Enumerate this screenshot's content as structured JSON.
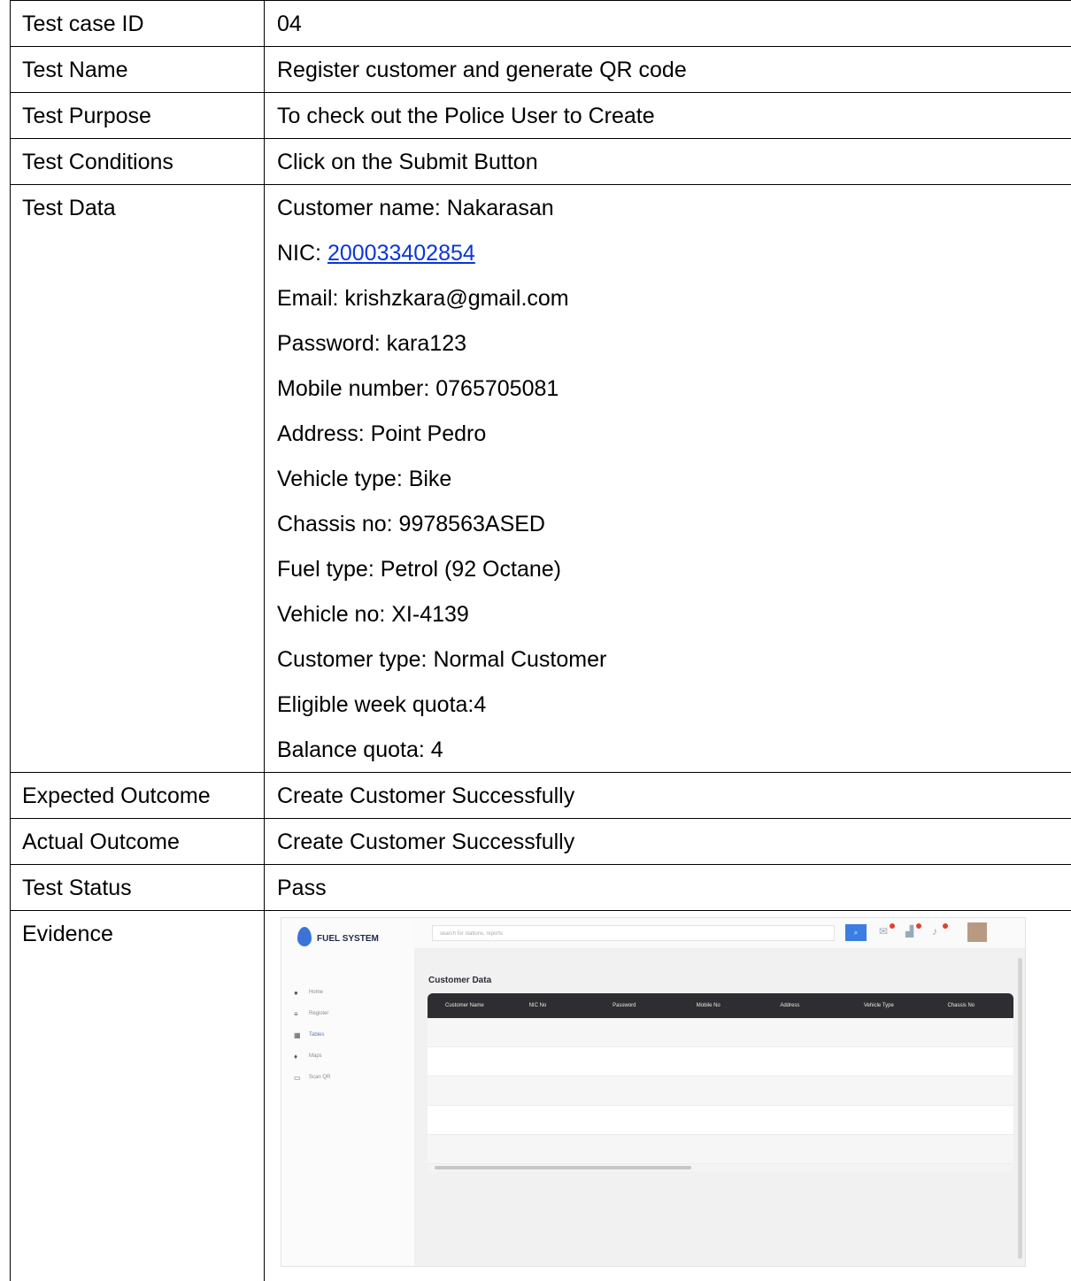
{
  "rows": {
    "test_case_id": {
      "label": "Test case ID",
      "value": "04"
    },
    "test_name": {
      "label": "Test Name",
      "value": "Register customer and generate QR code"
    },
    "test_purpose": {
      "label": "Test Purpose",
      "value": "To check out the Police User to Create"
    },
    "test_conditions": {
      "label": "Test Conditions",
      "value": "Click on the Submit Button"
    },
    "test_data": {
      "label": "Test Data",
      "lines": {
        "customer_name": "Customer name: Nakarasan",
        "nic_prefix": "NIC: ",
        "nic_value": "200033402854",
        "email": "Email: krishzkara@gmail.com",
        "password": "Password: kara123",
        "mobile": "Mobile number: 0765705081",
        "address": "Address: Point Pedro",
        "vehicle_type": "Vehicle type: Bike",
        "chassis": "Chassis no: 9978563ASED",
        "fuel_type": "Fuel type: Petrol (92 Octane)",
        "vehicle_no": "Vehicle no: XI-4139",
        "customer_type": "Customer type: Normal Customer",
        "eligible_quota": "Eligible week quota:4",
        "balance_quota": "Balance quota: 4"
      }
    },
    "expected_outcome": {
      "label": "Expected Outcome",
      "value": "Create Customer Successfully"
    },
    "actual_outcome": {
      "label": "Actual Outcome",
      "value": "Create Customer Successfully"
    },
    "test_status": {
      "label": "Test Status",
      "value": "Pass"
    },
    "evidence": {
      "label": "Evidence"
    }
  },
  "evidence_screenshot": {
    "logo_text": "FUEL SYSTEM",
    "search_placeholder": "search for stations, reports",
    "search_icon": "search-icon",
    "page_title": "Customer Data",
    "nav_items": [
      "Home",
      "Register",
      "Tables",
      "Maps",
      "Scan QR"
    ],
    "columns": [
      "Customer Name",
      "NIC No",
      "Password",
      "Mobile No",
      "Address",
      "Vehicle Type",
      "Chassis No"
    ],
    "colors": {
      "link": "#0b35d9",
      "accent": "#3b7de0",
      "table_header": "#2e2e32"
    }
  }
}
